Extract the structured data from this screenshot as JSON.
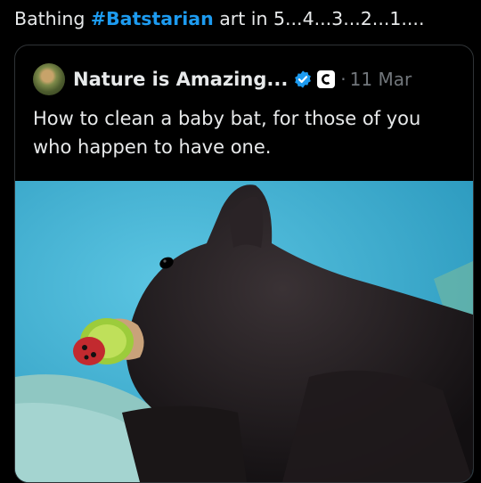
{
  "post": {
    "text_before": "Bathing ",
    "hashtag": "#Batstarian",
    "text_after": " art in 5...4...3...2...1...."
  },
  "quoted": {
    "display_name": "Nature is Amazing...",
    "separator": "·",
    "date": "11 Mar",
    "text": "How to clean a baby bat, for those of you who happen to have one.",
    "verified_icon": "verified-badge-icon",
    "affiliate_icon": "affiliate-badge-icon",
    "accent_color": "#1d9bf0"
  },
  "media": {
    "subject": "baby-bat-with-pacifier-photo"
  }
}
